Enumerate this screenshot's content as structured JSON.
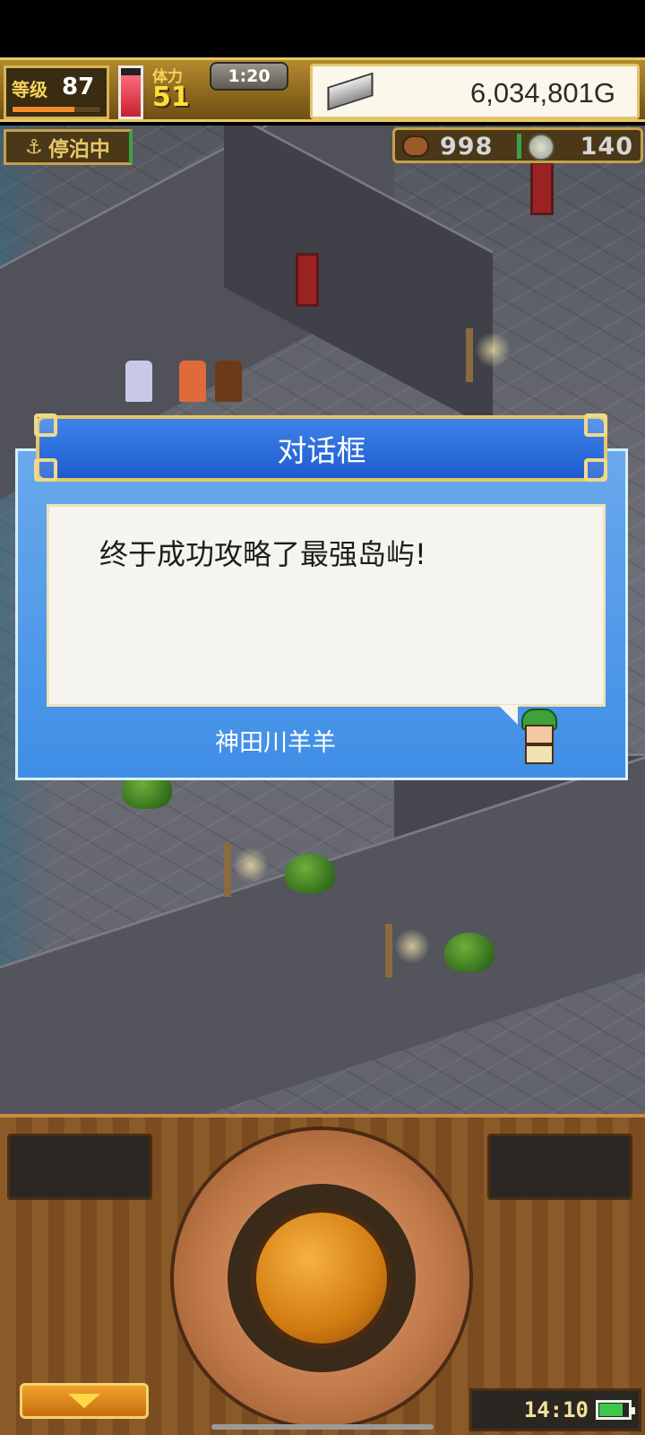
{
  "hud": {
    "level_label": "等级",
    "level_value": "87",
    "level_progress_pct": 70,
    "stamina_label": "体力",
    "stamina_value": "51",
    "stamina_fill_pct": 85,
    "timer": "1:20",
    "gold": "6,034,801G",
    "status": "停泊中",
    "food": "998",
    "medals": "140"
  },
  "dialog": {
    "title": "对话框",
    "message": "终于成功攻略了最强岛屿!",
    "speaker": "神田川羊羊"
  },
  "footer": {
    "clock": "14:10",
    "battery_pct": 85
  },
  "icons": {
    "status": "anchor-icon",
    "food": "food-icon",
    "medals": "medal-icon",
    "gold": "silver-bar-icon",
    "menu": "down-arrow-icon"
  },
  "colors": {
    "dialog_blue": "#3f8ee6",
    "header_blue": "#1d5ccf",
    "gold_trim": "#e5c766"
  }
}
